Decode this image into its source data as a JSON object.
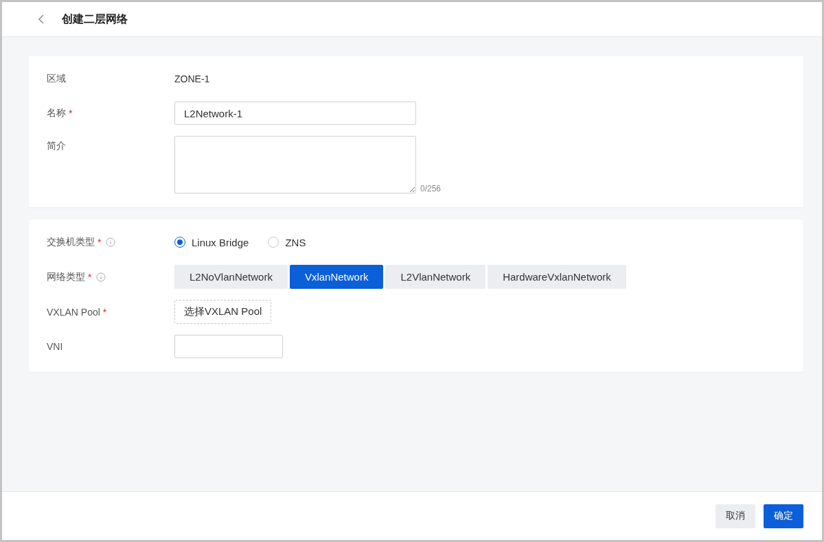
{
  "header": {
    "title": "创建二层网络"
  },
  "sections": [
    {
      "fields": [
        {
          "kind": "static",
          "label": "区域",
          "info": false,
          "value": "ZONE-1"
        },
        {
          "kind": "input",
          "label": "名称",
          "required_mark": "*",
          "info": false,
          "value": "L2Network-1"
        },
        {
          "kind": "textarea",
          "label": "简介",
          "info": false,
          "counter": "0/256"
        }
      ]
    },
    {
      "fields": [
        {
          "kind": "radio",
          "label": "交换机类型",
          "required_mark": "*",
          "info": true,
          "options": [
            {
              "label": "Linux Bridge",
              "selected": true
            },
            {
              "label": "ZNS",
              "selected": false
            }
          ]
        },
        {
          "kind": "segmented",
          "label": "网络类型",
          "required_mark": "*",
          "info": true,
          "options": [
            {
              "label": "L2NoVlanNetwork",
              "selected": false
            },
            {
              "label": "VxlanNetwork",
              "selected": true
            },
            {
              "label": "L2VlanNetwork",
              "selected": false
            },
            {
              "label": "HardwareVxlanNetwork",
              "selected": false
            }
          ]
        },
        {
          "kind": "picker",
          "label": "VXLAN Pool",
          "required_mark": "*",
          "info": false,
          "button": "选择VXLAN Pool"
        },
        {
          "kind": "input",
          "label": "VNI",
          "info": false
        }
      ]
    }
  ],
  "footer": {
    "cancel": "取消",
    "confirm": "确定"
  }
}
